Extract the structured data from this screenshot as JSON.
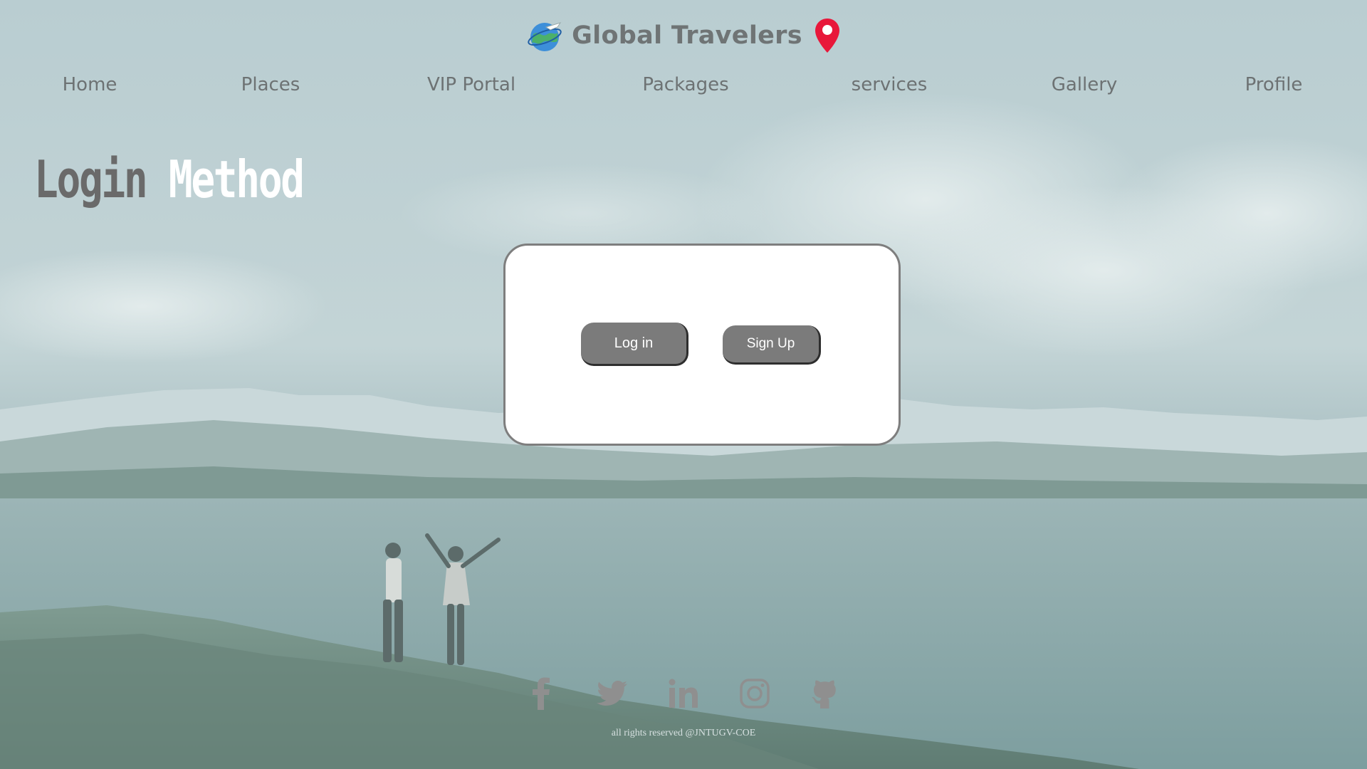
{
  "brand": {
    "title": "Global Travelers",
    "logo_icon": "globe-plane-icon",
    "pin_icon": "map-pin-icon",
    "pin_color": "#e8173a"
  },
  "nav": {
    "items": [
      {
        "label": "Home"
      },
      {
        "label": "Places"
      },
      {
        "label": "VIP Portal"
      },
      {
        "label": "Packages"
      },
      {
        "label": "services"
      },
      {
        "label": "Gallery"
      },
      {
        "label": "Profile"
      }
    ]
  },
  "heading": {
    "word1": "Login",
    "word2": "Method"
  },
  "auth_card": {
    "login_label": "Log in",
    "signup_label": "Sign Up"
  },
  "social": {
    "icons": [
      "facebook-icon",
      "twitter-icon",
      "linkedin-icon",
      "instagram-icon",
      "github-icon"
    ]
  },
  "footer": {
    "text": "all rights reserved @JNTUGV-COE"
  },
  "colors": {
    "overlay_tint": "#8fb3b5",
    "button_bg": "#7b7b7b",
    "nav_text": "#6d7273",
    "icon_color": "#8f8f8f"
  }
}
